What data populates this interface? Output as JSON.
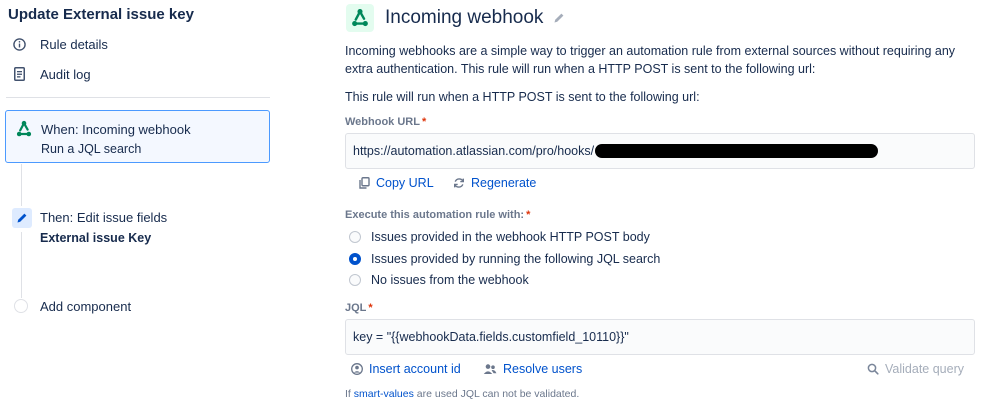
{
  "colors": {
    "accent": "#0052cc",
    "selected_border": "#4c9aff",
    "webhook_green": "#00875a",
    "required": "#de350b"
  },
  "sidebar": {
    "rule_title": "Update External issue key",
    "nav": [
      {
        "icon": "info-icon",
        "label": "Rule details"
      },
      {
        "icon": "document-icon",
        "label": "Audit log"
      }
    ],
    "trigger": {
      "icon": "webhook-icon",
      "title": "When: Incoming webhook",
      "subtitle": "Run a JQL search"
    },
    "action": {
      "icon": "pencil-icon",
      "title": "Then: Edit issue fields",
      "subtitle": "External issue Key"
    },
    "add_component": "Add component"
  },
  "main": {
    "header": {
      "icon": "webhook-icon",
      "title": "Incoming webhook",
      "edit_icon": "pencil-icon"
    },
    "description": "Incoming webhooks are a simple way to trigger an automation rule from external sources without requiring any extra authentication. This rule will run when a HTTP POST is sent to the following url:",
    "description_2": "This rule will run when a HTTP POST is sent to the following url:",
    "webhook_url": {
      "label": "Webhook URL",
      "value": "https://automation.atlassian.com/pro/hooks/",
      "copy_label": "Copy URL",
      "regenerate_label": "Regenerate"
    },
    "execute": {
      "label": "Execute this automation rule with:",
      "options": [
        {
          "label": "Issues provided in the webhook HTTP POST body",
          "selected": false
        },
        {
          "label": "Issues provided by running the following JQL search",
          "selected": true
        },
        {
          "label": "No issues from the webhook",
          "selected": false
        }
      ]
    },
    "jql": {
      "label": "JQL",
      "value": "key = \"{{webhookData.fields.customfield_10110}}\"",
      "insert_account_label": "Insert account id",
      "resolve_users_label": "Resolve users",
      "validate_label": "Validate query",
      "hint_prefix": "If ",
      "hint_link": "smart-values",
      "hint_suffix": " are used JQL can not be validated."
    }
  }
}
